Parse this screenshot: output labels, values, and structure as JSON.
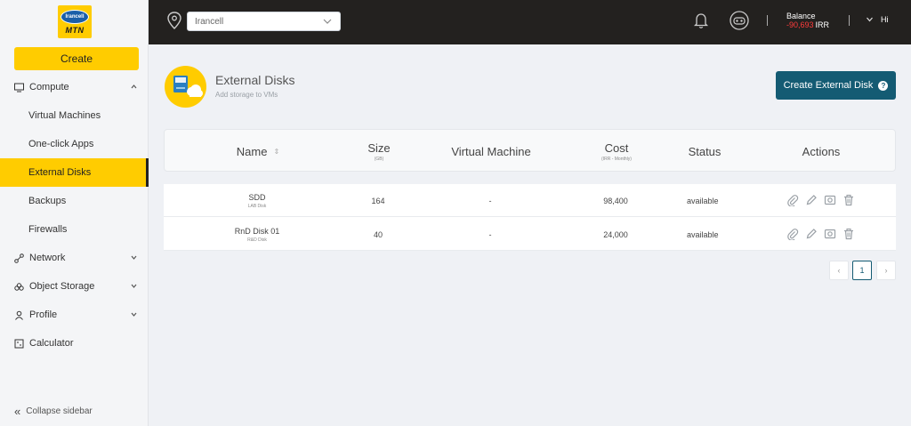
{
  "sidebar": {
    "logo": {
      "line1": "Irancell",
      "line2": "MTN"
    },
    "create_label": "Create",
    "nav": {
      "compute": "Compute",
      "compute_items": [
        "Virtual Machines",
        "One-click Apps",
        "External Disks",
        "Backups",
        "Firewalls"
      ],
      "network": "Network",
      "object_storage": "Object Storage",
      "profile": "Profile",
      "calculator": "Calculator"
    },
    "collapse_label": "Collapse sidebar"
  },
  "topbar": {
    "project": "Irancell",
    "balance_label": "Balance",
    "balance_amount": "-90,693",
    "balance_currency": "IRR",
    "greeting": "Hi"
  },
  "header": {
    "title": "External Disks",
    "subtitle": "Add storage to VMs",
    "cta_label": "Create External Disk",
    "help_glyph": "?"
  },
  "table": {
    "columns": {
      "name": "Name",
      "size": "Size",
      "size_unit": "(GB)",
      "vm": "Virtual Machine",
      "cost": "Cost",
      "cost_unit": "(IRR - Monthly)",
      "status": "Status",
      "actions": "Actions"
    },
    "rows": [
      {
        "name": "SDD",
        "description": "LAB Disk",
        "size": "164",
        "vm": "-",
        "cost": "98,400",
        "status": "available"
      },
      {
        "name": "RnD Disk 01",
        "description": "R&D Disk",
        "size": "40",
        "vm": "-",
        "cost": "24,000",
        "status": "available"
      }
    ]
  },
  "pagination": {
    "prev": "‹",
    "current": "1",
    "next": "›"
  },
  "colors": {
    "accent": "#ffcc00",
    "primary": "#145b73",
    "topbar": "#23211f",
    "negative": "#ff3b3b"
  }
}
